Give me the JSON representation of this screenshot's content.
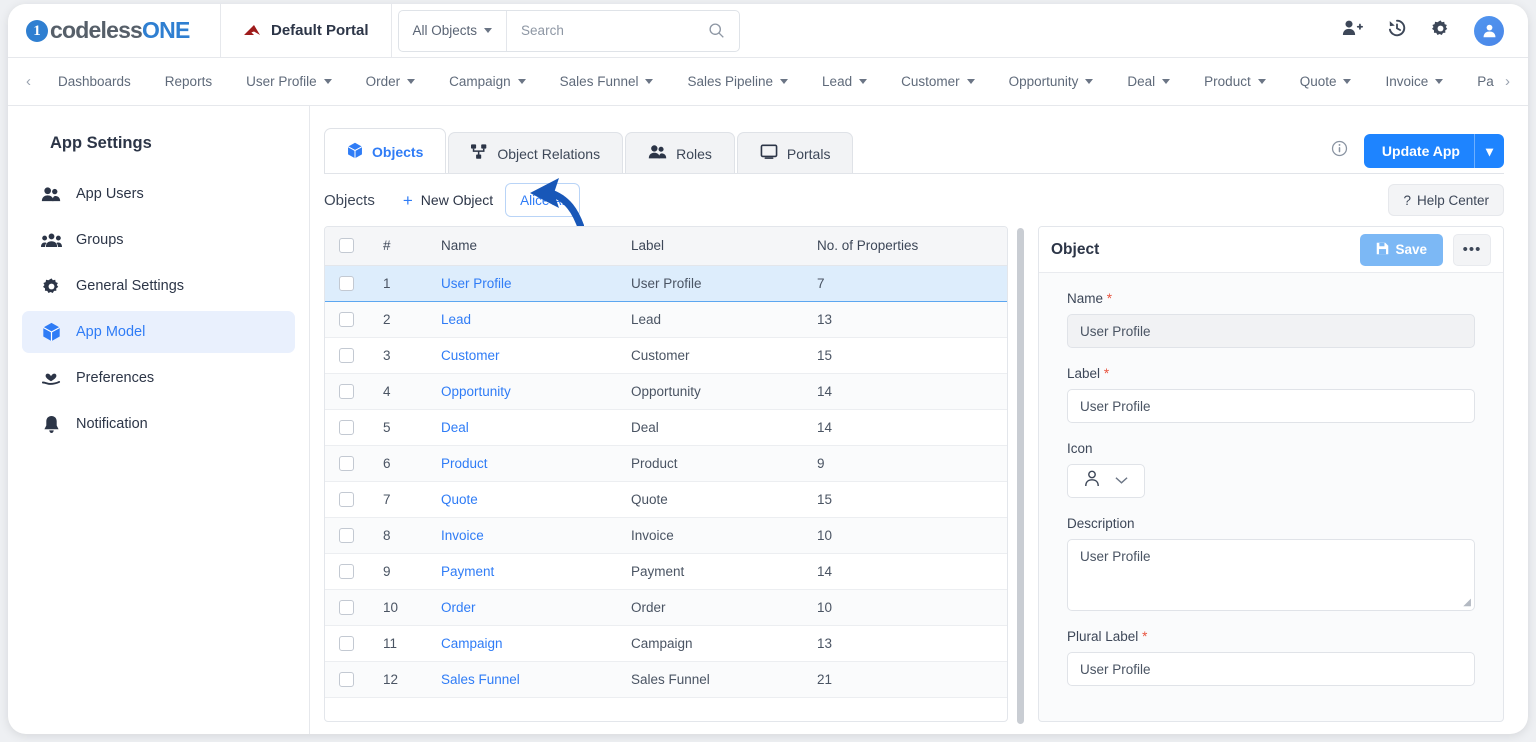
{
  "header": {
    "logo": {
      "mark": "1",
      "text_dark": "codeless",
      "text_blue": "ONE"
    },
    "portal_name": "Default Portal",
    "portal_icon": "red-arrow-icon",
    "search": {
      "scope": "All Objects",
      "placeholder": "Search",
      "value": ""
    },
    "icons": [
      "add-user-icon",
      "history-icon",
      "gear-icon",
      "user-avatar-icon"
    ]
  },
  "nav": {
    "prev_label": "‹",
    "next_label": "›",
    "items": [
      {
        "label": "Dashboards",
        "has_dropdown": false
      },
      {
        "label": "Reports",
        "has_dropdown": false
      },
      {
        "label": "User Profile",
        "has_dropdown": true
      },
      {
        "label": "Order",
        "has_dropdown": true
      },
      {
        "label": "Campaign",
        "has_dropdown": true
      },
      {
        "label": "Sales Funnel",
        "has_dropdown": true
      },
      {
        "label": "Sales Pipeline",
        "has_dropdown": true
      },
      {
        "label": "Lead",
        "has_dropdown": true
      },
      {
        "label": "Customer",
        "has_dropdown": true
      },
      {
        "label": "Opportunity",
        "has_dropdown": true
      },
      {
        "label": "Deal",
        "has_dropdown": true
      },
      {
        "label": "Product",
        "has_dropdown": true
      },
      {
        "label": "Quote",
        "has_dropdown": true
      },
      {
        "label": "Invoice",
        "has_dropdown": true
      },
      {
        "label": "Pa",
        "has_dropdown": false
      }
    ]
  },
  "sidebar": {
    "title": "App Settings",
    "items": [
      {
        "label": "App Users",
        "icon": "users-icon",
        "active": false
      },
      {
        "label": "Groups",
        "icon": "group-icon",
        "active": false
      },
      {
        "label": "General Settings",
        "icon": "gear-icon",
        "active": false
      },
      {
        "label": "App Model",
        "icon": "cube-icon",
        "active": true
      },
      {
        "label": "Preferences",
        "icon": "hand-heart-icon",
        "active": false
      },
      {
        "label": "Notification",
        "icon": "bell-icon",
        "active": false
      }
    ]
  },
  "tabs": [
    {
      "label": "Objects",
      "icon": "cube-icon",
      "active": true
    },
    {
      "label": "Object Relations",
      "icon": "relations-icon",
      "active": false
    },
    {
      "label": "Roles",
      "icon": "users-icon",
      "active": false
    },
    {
      "label": "Portals",
      "icon": "monitor-icon",
      "active": false
    }
  ],
  "tabs_right": {
    "info_icon": "info-icon",
    "update_app_label": "Update App",
    "update_app_caret": "▾"
  },
  "toolbar": {
    "title": "Objects",
    "new_object_label": "New Object",
    "new_object_plus": "+",
    "alice_ai_label": "Alice AI",
    "help_center_label": "Help Center",
    "help_center_icon": "question-mark-icon",
    "annotation": "left-pointing-arrow"
  },
  "table": {
    "columns": [
      "",
      "#",
      "Name",
      "Label",
      "No. of Properties"
    ],
    "rows": [
      {
        "num": "1",
        "name": "User Profile",
        "label": "User Profile",
        "props": "7",
        "selected": true
      },
      {
        "num": "2",
        "name": "Lead",
        "label": "Lead",
        "props": "13",
        "selected": false
      },
      {
        "num": "3",
        "name": "Customer",
        "label": "Customer",
        "props": "15",
        "selected": false
      },
      {
        "num": "4",
        "name": "Opportunity",
        "label": "Opportunity",
        "props": "14",
        "selected": false
      },
      {
        "num": "5",
        "name": "Deal",
        "label": "Deal",
        "props": "14",
        "selected": false
      },
      {
        "num": "6",
        "name": "Product",
        "label": "Product",
        "props": "9",
        "selected": false
      },
      {
        "num": "7",
        "name": "Quote",
        "label": "Quote",
        "props": "15",
        "selected": false
      },
      {
        "num": "8",
        "name": "Invoice",
        "label": "Invoice",
        "props": "10",
        "selected": false
      },
      {
        "num": "9",
        "name": "Payment",
        "label": "Payment",
        "props": "14",
        "selected": false
      },
      {
        "num": "10",
        "name": "Order",
        "label": "Order",
        "props": "10",
        "selected": false
      },
      {
        "num": "11",
        "name": "Campaign",
        "label": "Campaign",
        "props": "13",
        "selected": false
      },
      {
        "num": "12",
        "name": "Sales Funnel",
        "label": "Sales Funnel",
        "props": "21",
        "selected": false
      }
    ]
  },
  "panel": {
    "title": "Object",
    "save_label": "Save",
    "save_icon": "floppy-disk-icon",
    "more_label": "•••",
    "fields": {
      "name_label": "Name",
      "name_value": "User Profile",
      "label_label": "Label",
      "label_value": "User Profile",
      "icon_label": "Icon",
      "icon_value": "person-icon",
      "description_label": "Description",
      "description_value": "User Profile",
      "plural_label_label": "Plural Label",
      "plural_label_value": "User Profile",
      "required_mark": "*"
    }
  },
  "colors": {
    "accent_blue": "#2f7cf6",
    "primary_button": "#1e84ff",
    "save_button": "#7cb8f5",
    "selected_row": "#ddedfc",
    "sidebar_active": "#e9f0fd",
    "required_red": "#e8543f",
    "logo_blue": "#2f7fd1",
    "portal_icon_red": "#9e1b1b"
  }
}
